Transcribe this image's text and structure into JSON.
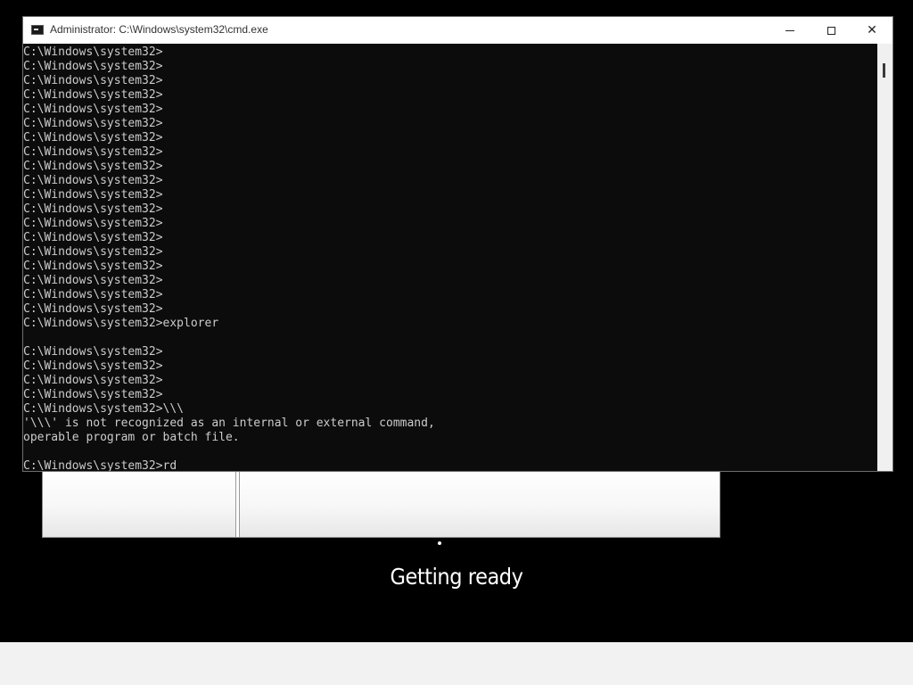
{
  "window": {
    "title": "Administrator: C:\\Windows\\system32\\cmd.exe",
    "app_icon": "cmd-icon",
    "controls": {
      "minimize": "minimize-icon",
      "maximize": "maximize-icon",
      "close": "close-icon",
      "close_glyph": "✕"
    }
  },
  "console": {
    "lines": [
      "C:\\Windows\\system32>",
      "C:\\Windows\\system32>",
      "C:\\Windows\\system32>",
      "C:\\Windows\\system32>",
      "C:\\Windows\\system32>",
      "C:\\Windows\\system32>",
      "C:\\Windows\\system32>",
      "C:\\Windows\\system32>",
      "C:\\Windows\\system32>",
      "C:\\Windows\\system32>",
      "C:\\Windows\\system32>",
      "C:\\Windows\\system32>",
      "C:\\Windows\\system32>",
      "C:\\Windows\\system32>",
      "C:\\Windows\\system32>",
      "C:\\Windows\\system32>",
      "C:\\Windows\\system32>",
      "C:\\Windows\\system32>",
      "C:\\Windows\\system32>",
      "C:\\Windows\\system32>explorer",
      "",
      "C:\\Windows\\system32>",
      "C:\\Windows\\system32>",
      "C:\\Windows\\system32>",
      "C:\\Windows\\system32>",
      "C:\\Windows\\system32>\\\\\\",
      "'\\\\\\' is not recognized as an internal or external command,",
      "operable program or batch file.",
      "",
      "C:\\Windows\\system32>rd"
    ]
  },
  "setup": {
    "status": "Getting ready"
  },
  "colors": {
    "console_bg": "#0c0c0c",
    "console_text": "#cccccc",
    "desktop_bg": "#000000",
    "bottom_band": "#f2f2f2"
  }
}
